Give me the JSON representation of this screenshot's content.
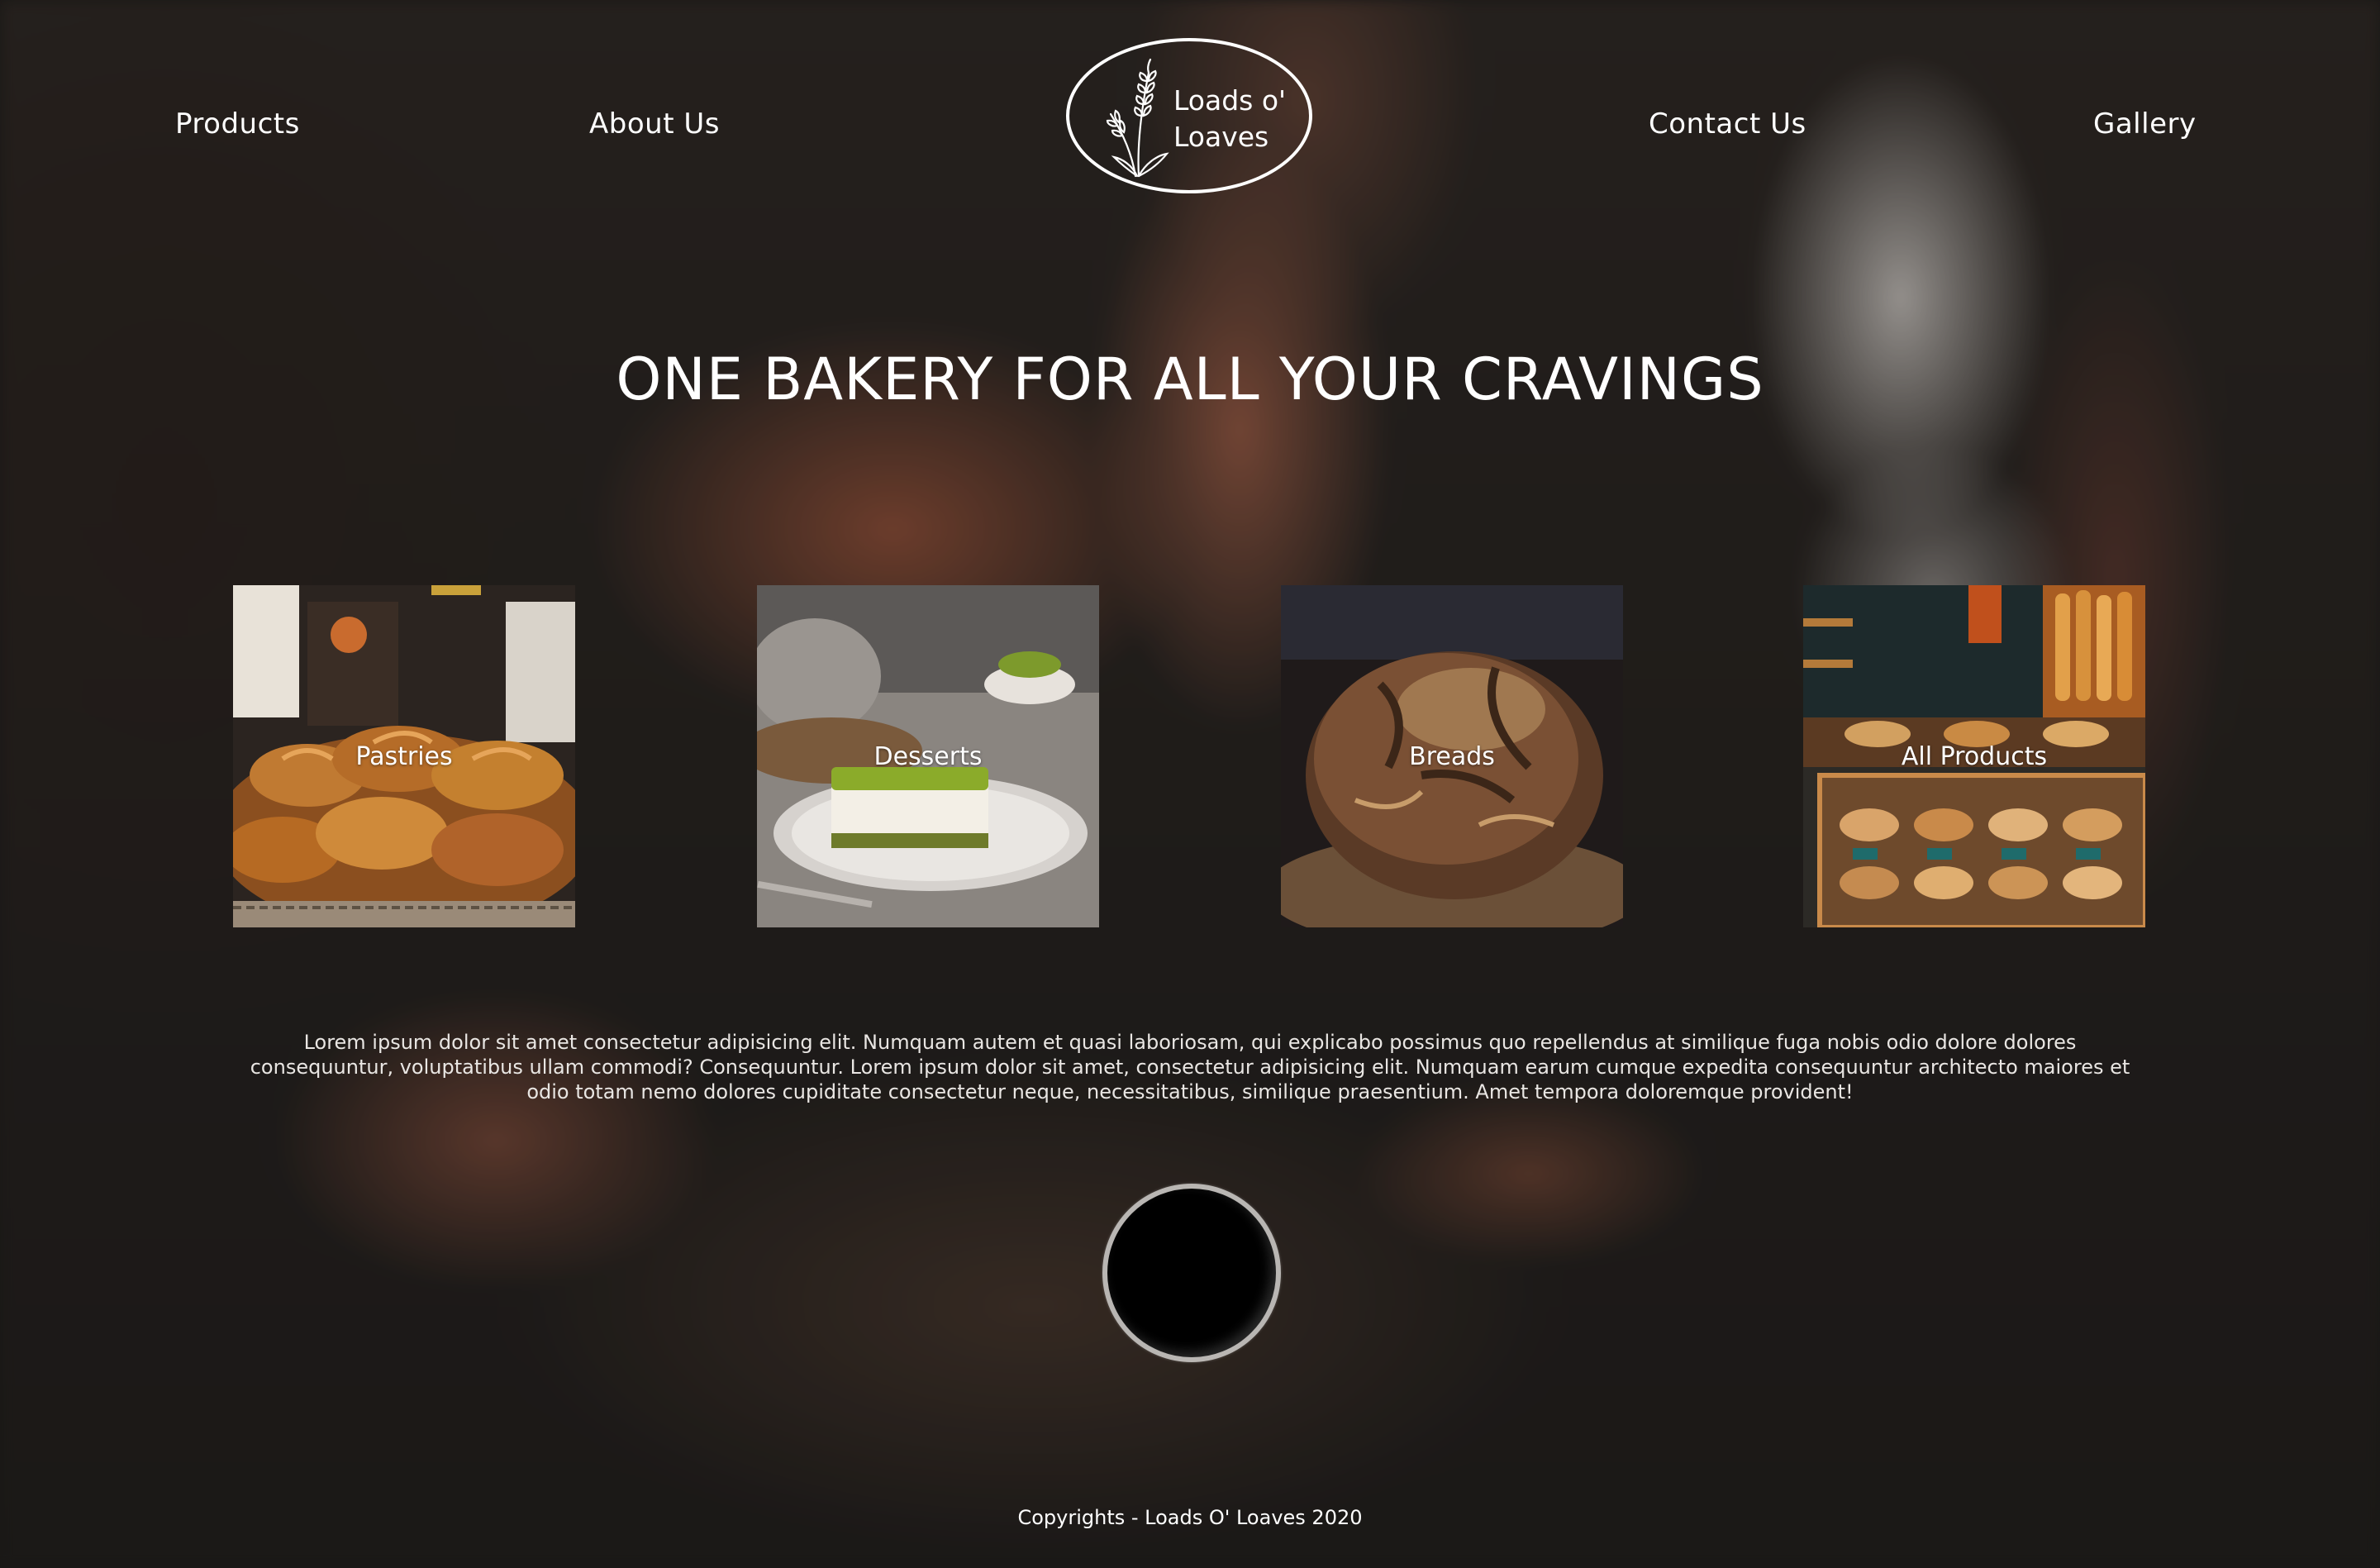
{
  "nav": {
    "products": "Products",
    "about": "About Us",
    "contact": "Contact Us",
    "gallery": "Gallery"
  },
  "logo": {
    "line1": "Loads o'",
    "line2": "Loaves",
    "icon": "wheat-icon"
  },
  "hero": {
    "headline": "ONE BAKERY FOR ALL YOUR CRAVINGS"
  },
  "categories": [
    {
      "label": "Pastries"
    },
    {
      "label": "Desserts"
    },
    {
      "label": "Breads"
    },
    {
      "label": "All Products"
    }
  ],
  "intro": {
    "text": "Lorem ipsum dolor sit amet consectetur adipisicing elit. Numquam autem et quasi laboriosam, qui explicabo possimus quo repellendus at similique fuga nobis odio dolore dolores consequuntur, voluptatibus ullam commodi? Consequuntur. Lorem ipsum dolor sit amet, consectetur adipisicing elit. Numquam earum cumque expedita consequuntur architecto maiores et odio totam nemo dolores cupiditate consectetur neque, necessitatibus, similique praesentium. Amet tempora doloremque provident!"
  },
  "footer": {
    "copyright": "Copyrights - Loads O' Loaves 2020"
  },
  "colors": {
    "text": "#ffffff",
    "background": "#1c1a18",
    "button": "#000000",
    "button_ring": "#b9b6b3"
  }
}
